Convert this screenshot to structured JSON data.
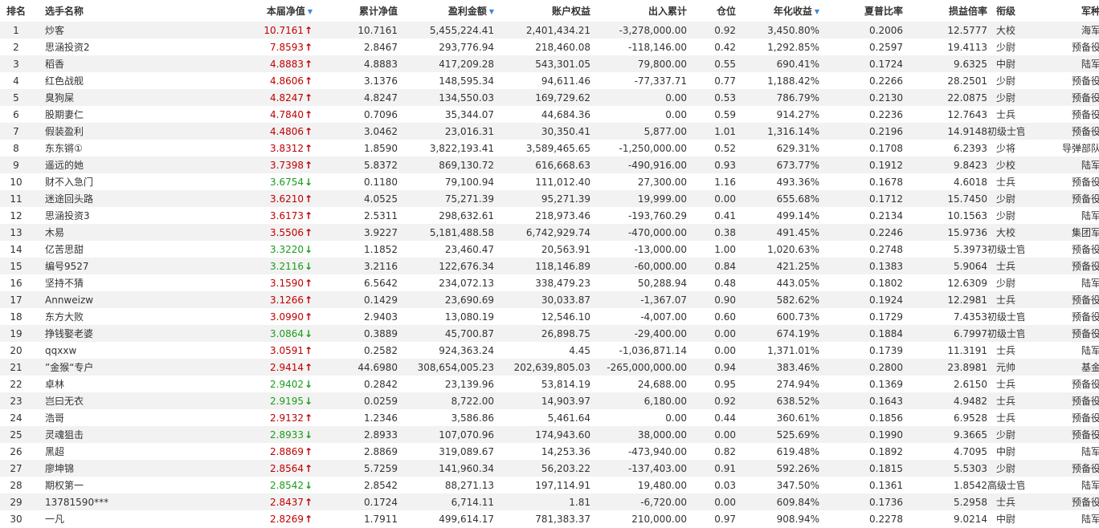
{
  "headers": {
    "rank": "排名",
    "name": "选手名称",
    "week_nav": "本届净值",
    "cum_nav": "累计净值",
    "profit": "盈利金额",
    "equity": "账户权益",
    "inout": "出入累计",
    "position": "仓位",
    "annual": "年化收益",
    "sharpe": "夏普比率",
    "pl_ratio": "损益倍率",
    "rank_title": "衔级",
    "army": "军种"
  },
  "sort_icon": "sort-down-triangle",
  "colors": {
    "up": "#c00000",
    "down": "#1a9d1a",
    "sort": "#3d87d6",
    "stripe": "#f2f2f2"
  },
  "rows": [
    {
      "rank": "1",
      "name": "炒客",
      "nav": "10.7161",
      "dir": "up",
      "cum": "10.7161",
      "profit": "5,455,224.41",
      "equity": "2,401,434.21",
      "inout": "-3,278,000.00",
      "pos": "0.92",
      "annual": "3,450.80%",
      "sharpe": "0.2006",
      "pl": "12.5777",
      "title": "大校",
      "army": "海军"
    },
    {
      "rank": "2",
      "name": "思涵投资2",
      "nav": "7.8593",
      "dir": "up",
      "cum": "2.8467",
      "profit": "293,776.94",
      "equity": "218,460.08",
      "inout": "-118,146.00",
      "pos": "0.42",
      "annual": "1,292.85%",
      "sharpe": "0.2597",
      "pl": "19.4113",
      "title": "少尉",
      "army": "预备役"
    },
    {
      "rank": "3",
      "name": "稻香",
      "nav": "4.8883",
      "dir": "up",
      "cum": "4.8883",
      "profit": "417,209.28",
      "equity": "543,301.05",
      "inout": "79,800.00",
      "pos": "0.55",
      "annual": "690.41%",
      "sharpe": "0.1724",
      "pl": "9.6325",
      "title": "中尉",
      "army": "陆军"
    },
    {
      "rank": "4",
      "name": "红色战舰",
      "nav": "4.8606",
      "dir": "up",
      "cum": "3.1376",
      "profit": "148,595.34",
      "equity": "94,611.46",
      "inout": "-77,337.71",
      "pos": "0.77",
      "annual": "1,188.42%",
      "sharpe": "0.2266",
      "pl": "28.2501",
      "title": "少尉",
      "army": "预备役"
    },
    {
      "rank": "5",
      "name": "臭狗屎",
      "nav": "4.8247",
      "dir": "up",
      "cum": "4.8247",
      "profit": "134,550.03",
      "equity": "169,729.62",
      "inout": "0.00",
      "pos": "0.53",
      "annual": "786.79%",
      "sharpe": "0.2130",
      "pl": "22.0875",
      "title": "少尉",
      "army": "预备役"
    },
    {
      "rank": "6",
      "name": "股期妻仁",
      "nav": "4.7840",
      "dir": "up",
      "cum": "0.7096",
      "profit": "35,344.07",
      "equity": "44,684.36",
      "inout": "0.00",
      "pos": "0.59",
      "annual": "914.27%",
      "sharpe": "0.2236",
      "pl": "12.7643",
      "title": "士兵",
      "army": "预备役"
    },
    {
      "rank": "7",
      "name": "假装盈利",
      "nav": "4.4806",
      "dir": "up",
      "cum": "3.0462",
      "profit": "23,016.31",
      "equity": "30,350.41",
      "inout": "5,877.00",
      "pos": "1.01",
      "annual": "1,316.14%",
      "sharpe": "0.2196",
      "pl": "14.9148",
      "title": "初级士官",
      "army": "预备役"
    },
    {
      "rank": "8",
      "name": "东东锵①",
      "nav": "3.8312",
      "dir": "up",
      "cum": "1.8590",
      "profit": "3,822,193.41",
      "equity": "3,589,465.65",
      "inout": "-1,250,000.00",
      "pos": "0.52",
      "annual": "629.31%",
      "sharpe": "0.1708",
      "pl": "6.2393",
      "title": "少将",
      "army": "导弹部队"
    },
    {
      "rank": "9",
      "name": "遥远的她",
      "nav": "3.7398",
      "dir": "up",
      "cum": "5.8372",
      "profit": "869,130.72",
      "equity": "616,668.63",
      "inout": "-490,916.00",
      "pos": "0.93",
      "annual": "673.77%",
      "sharpe": "0.1912",
      "pl": "9.8423",
      "title": "少校",
      "army": "陆军"
    },
    {
      "rank": "10",
      "name": "财不入急门",
      "nav": "3.6754",
      "dir": "down",
      "cum": "0.1180",
      "profit": "79,100.94",
      "equity": "111,012.40",
      "inout": "27,300.00",
      "pos": "1.16",
      "annual": "493.36%",
      "sharpe": "0.1678",
      "pl": "4.6018",
      "title": "士兵",
      "army": "预备役"
    },
    {
      "rank": "11",
      "name": "迷途回头路",
      "nav": "3.6210",
      "dir": "up",
      "cum": "4.0525",
      "profit": "75,271.39",
      "equity": "95,271.39",
      "inout": "19,999.00",
      "pos": "0.00",
      "annual": "655.68%",
      "sharpe": "0.1712",
      "pl": "15.7450",
      "title": "少尉",
      "army": "预备役"
    },
    {
      "rank": "12",
      "name": "思涵投资3",
      "nav": "3.6173",
      "dir": "up",
      "cum": "2.5311",
      "profit": "298,632.61",
      "equity": "218,973.46",
      "inout": "-193,760.29",
      "pos": "0.41",
      "annual": "499.14%",
      "sharpe": "0.2134",
      "pl": "10.1563",
      "title": "少尉",
      "army": "陆军"
    },
    {
      "rank": "13",
      "name": "木易",
      "nav": "3.5506",
      "dir": "up",
      "cum": "3.9227",
      "profit": "5,181,488.58",
      "equity": "6,742,929.74",
      "inout": "-470,000.00",
      "pos": "0.38",
      "annual": "491.45%",
      "sharpe": "0.2246",
      "pl": "15.9736",
      "title": "大校",
      "army": "集团军"
    },
    {
      "rank": "14",
      "name": "亿苦思甜",
      "nav": "3.3220",
      "dir": "down",
      "cum": "1.1852",
      "profit": "23,460.47",
      "equity": "20,563.91",
      "inout": "-13,000.00",
      "pos": "1.00",
      "annual": "1,020.63%",
      "sharpe": "0.2748",
      "pl": "5.3973",
      "title": "初级士官",
      "army": "预备役"
    },
    {
      "rank": "15",
      "name": "编号9527",
      "nav": "3.2116",
      "dir": "down",
      "cum": "3.2116",
      "profit": "122,676.34",
      "equity": "118,146.89",
      "inout": "-60,000.00",
      "pos": "0.84",
      "annual": "421.25%",
      "sharpe": "0.1383",
      "pl": "5.9064",
      "title": "士兵",
      "army": "预备役"
    },
    {
      "rank": "16",
      "name": "坚持不猜",
      "nav": "3.1590",
      "dir": "up",
      "cum": "6.5642",
      "profit": "234,072.13",
      "equity": "338,479.23",
      "inout": "50,288.94",
      "pos": "0.48",
      "annual": "443.05%",
      "sharpe": "0.1802",
      "pl": "12.6309",
      "title": "少尉",
      "army": "陆军"
    },
    {
      "rank": "17",
      "name": "Annweizw",
      "nav": "3.1266",
      "dir": "up",
      "cum": "0.1429",
      "profit": "23,690.69",
      "equity": "30,033.87",
      "inout": "-1,367.07",
      "pos": "0.90",
      "annual": "582.62%",
      "sharpe": "0.1924",
      "pl": "12.2981",
      "title": "士兵",
      "army": "预备役"
    },
    {
      "rank": "18",
      "name": "东方大败",
      "nav": "3.0990",
      "dir": "up",
      "cum": "2.9403",
      "profit": "13,080.19",
      "equity": "12,546.10",
      "inout": "-4,007.00",
      "pos": "0.60",
      "annual": "600.73%",
      "sharpe": "0.1729",
      "pl": "7.4353",
      "title": "初级士官",
      "army": "预备役"
    },
    {
      "rank": "19",
      "name": "挣钱娶老婆",
      "nav": "3.0864",
      "dir": "down",
      "cum": "0.3889",
      "profit": "45,700.87",
      "equity": "26,898.75",
      "inout": "-29,400.00",
      "pos": "0.00",
      "annual": "674.19%",
      "sharpe": "0.1884",
      "pl": "6.7997",
      "title": "初级士官",
      "army": "预备役"
    },
    {
      "rank": "20",
      "name": "qqxxw",
      "nav": "3.0591",
      "dir": "up",
      "cum": "0.2582",
      "profit": "924,363.24",
      "equity": "4.45",
      "inout": "-1,036,871.14",
      "pos": "0.00",
      "annual": "1,371.01%",
      "sharpe": "0.1739",
      "pl": "11.3191",
      "title": "士兵",
      "army": "陆军"
    },
    {
      "rank": "21",
      "name": "”金猴“专户",
      "nav": "2.9414",
      "dir": "up",
      "cum": "44.6980",
      "profit": "308,654,005.23",
      "equity": "202,639,805.03",
      "inout": "-265,000,000.00",
      "pos": "0.94",
      "annual": "383.46%",
      "sharpe": "0.2800",
      "pl": "23.8981",
      "title": "元帅",
      "army": "基金"
    },
    {
      "rank": "22",
      "name": "卓林",
      "nav": "2.9402",
      "dir": "down",
      "cum": "0.2842",
      "profit": "23,139.96",
      "equity": "53,814.19",
      "inout": "24,688.00",
      "pos": "0.95",
      "annual": "274.94%",
      "sharpe": "0.1369",
      "pl": "2.6150",
      "title": "士兵",
      "army": "预备役"
    },
    {
      "rank": "23",
      "name": "岂曰无衣",
      "nav": "2.9195",
      "dir": "down",
      "cum": "0.0259",
      "profit": "8,722.00",
      "equity": "14,903.97",
      "inout": "6,180.00",
      "pos": "0.92",
      "annual": "638.52%",
      "sharpe": "0.1643",
      "pl": "4.9482",
      "title": "士兵",
      "army": "预备役"
    },
    {
      "rank": "24",
      "name": "浩哥",
      "nav": "2.9132",
      "dir": "up",
      "cum": "1.2346",
      "profit": "3,586.86",
      "equity": "5,461.64",
      "inout": "0.00",
      "pos": "0.44",
      "annual": "360.61%",
      "sharpe": "0.1856",
      "pl": "6.9528",
      "title": "士兵",
      "army": "预备役"
    },
    {
      "rank": "25",
      "name": "灵魂狙击",
      "nav": "2.8933",
      "dir": "down",
      "cum": "2.8933",
      "profit": "107,070.96",
      "equity": "174,943.60",
      "inout": "38,000.00",
      "pos": "0.00",
      "annual": "525.69%",
      "sharpe": "0.1990",
      "pl": "9.3665",
      "title": "少尉",
      "army": "预备役"
    },
    {
      "rank": "26",
      "name": "黑超",
      "nav": "2.8869",
      "dir": "up",
      "cum": "2.8869",
      "profit": "319,089.67",
      "equity": "14,253.36",
      "inout": "-473,940.00",
      "pos": "0.82",
      "annual": "619.48%",
      "sharpe": "0.1892",
      "pl": "4.7095",
      "title": "中尉",
      "army": "陆军"
    },
    {
      "rank": "27",
      "name": "廖坤锦",
      "nav": "2.8564",
      "dir": "up",
      "cum": "5.7259",
      "profit": "141,960.34",
      "equity": "56,203.22",
      "inout": "-137,403.00",
      "pos": "0.91",
      "annual": "592.26%",
      "sharpe": "0.1815",
      "pl": "5.5303",
      "title": "少尉",
      "army": "预备役"
    },
    {
      "rank": "28",
      "name": "期权第一",
      "nav": "2.8542",
      "dir": "down",
      "cum": "2.8542",
      "profit": "88,271.13",
      "equity": "197,114.91",
      "inout": "19,480.00",
      "pos": "0.03",
      "annual": "347.50%",
      "sharpe": "0.1361",
      "pl": "1.8542",
      "title": "高级士官",
      "army": "陆军"
    },
    {
      "rank": "29",
      "name": "13781590***",
      "nav": "2.8437",
      "dir": "up",
      "cum": "0.1724",
      "profit": "6,714.11",
      "equity": "1.81",
      "inout": "-6,720.00",
      "pos": "0.00",
      "annual": "609.84%",
      "sharpe": "0.1736",
      "pl": "5.2958",
      "title": "士兵",
      "army": "预备役"
    },
    {
      "rank": "30",
      "name": "一凡",
      "nav": "2.8269",
      "dir": "up",
      "cum": "1.7911",
      "profit": "499,614.17",
      "equity": "781,383.37",
      "inout": "210,000.00",
      "pos": "0.97",
      "annual": "908.94%",
      "sharpe": "0.2278",
      "pl": "9.0214",
      "title": "中尉",
      "army": "陆军"
    }
  ]
}
